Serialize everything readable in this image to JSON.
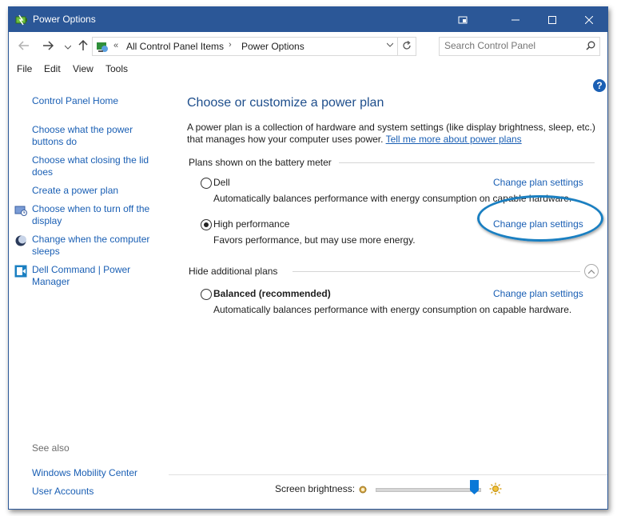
{
  "window": {
    "title": "Power Options"
  },
  "address": {
    "chevron": "«",
    "crumbs": [
      "All Control Panel Items",
      "Power Options"
    ],
    "separator": "›"
  },
  "search": {
    "placeholder": "Search Control Panel"
  },
  "menu": [
    "File",
    "Edit",
    "View",
    "Tools"
  ],
  "sidebar": {
    "home": "Control Panel Home",
    "items": [
      {
        "label": "Choose what the power buttons do"
      },
      {
        "label": "Choose what closing the lid does"
      },
      {
        "label": "Create a power plan"
      },
      {
        "label": "Choose when to turn off the display",
        "icon": "monitor-clock-icon"
      },
      {
        "label": "Change when the computer sleeps",
        "icon": "moon-icon"
      },
      {
        "label": "Dell Command | Power Manager",
        "icon": "dell-power-icon"
      }
    ],
    "see_also_label": "See also",
    "see_also": [
      "Windows Mobility Center",
      "User Accounts"
    ]
  },
  "main": {
    "help": "?",
    "heading": "Choose or customize a power plan",
    "description": "A power plan is a collection of hardware and system settings (like display brightness, sleep, etc.) that manages how your computer uses power.",
    "description_link": "Tell me more about power plans",
    "battery_section": "Plans shown on the battery meter",
    "hidden_section": "Hide additional plans",
    "plans": [
      {
        "name": "Dell",
        "desc": "Automatically balances performance with energy consumption on capable hardware.",
        "link": "Change plan settings",
        "selected": false
      },
      {
        "name": "High performance",
        "desc": "Favors performance, but may use more energy.",
        "link": "Change plan settings",
        "selected": true
      },
      {
        "name": "Balanced (recommended)",
        "desc": "Automatically balances performance with energy consumption on capable hardware.",
        "link": "Change plan settings",
        "selected": false
      }
    ]
  },
  "footer": {
    "brightness_label": "Screen brightness:",
    "brightness_level": 0.93
  },
  "colors": {
    "titlebar": "#2b5797",
    "link": "#1a5fb4",
    "heading": "#1e4e8c",
    "highlight": "#1a7fc1"
  }
}
